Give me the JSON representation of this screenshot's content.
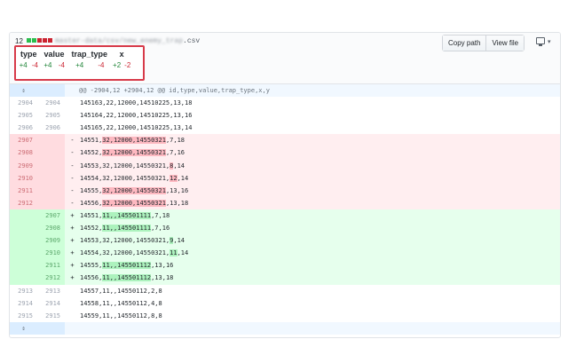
{
  "file": {
    "diffstat_count": "12",
    "diffstat_blocks": [
      "#2cbe4e",
      "#2cbe4e",
      "#cb2431",
      "#cb2431",
      "#cb2431"
    ],
    "path_blurred": "master-data/csv/new_enemy_trap",
    "path_ext": ".csv",
    "copy_path_label": "Copy path",
    "view_file_label": "View file",
    "display_icon": "monitor-icon",
    "caret_icon": "caret-down"
  },
  "summary": {
    "headers": [
      "type",
      "value",
      "trap_type",
      "x"
    ],
    "values": [
      "+4",
      "-4",
      "+4",
      "-4",
      "+4",
      "-4",
      "+2",
      "-2"
    ]
  },
  "hunk": {
    "expand_icon": "⇕",
    "header": "@@ -2904,12 +2904,12 @@ id,type,value,trap_type,x,y",
    "end_icon": "⇕"
  },
  "colors": {
    "del_bg": "#ffeef0",
    "del_highlight": "#fdb8c0",
    "add_bg": "#e6ffed",
    "add_highlight": "#acf2bd",
    "annotation_border": "#d73a49"
  },
  "context_top": [
    {
      "old": "2904",
      "new": "2904",
      "text": "145163,22,12000,14510225,13,18"
    },
    {
      "old": "2905",
      "new": "2905",
      "text": "145164,22,12000,14510225,13,16"
    },
    {
      "old": "2906",
      "new": "2906",
      "text": "145165,22,12000,14510225,13,14"
    }
  ],
  "deletions": [
    {
      "old": "2907",
      "sign": "-",
      "parts": [
        {
          "t": "14551,"
        },
        {
          "t": "32,12000,14550321",
          "h": true
        },
        {
          "t": ",7,18"
        }
      ]
    },
    {
      "old": "2908",
      "sign": "-",
      "parts": [
        {
          "t": "14552,"
        },
        {
          "t": "32,12000,14550321",
          "h": true
        },
        {
          "t": ",7,16"
        }
      ]
    },
    {
      "old": "2909",
      "sign": "-",
      "parts": [
        {
          "t": "14553,32,12000,14550321,"
        },
        {
          "t": "8",
          "h": true
        },
        {
          "t": ",14"
        }
      ]
    },
    {
      "old": "2910",
      "sign": "-",
      "parts": [
        {
          "t": "14554,32,12000,14550321,"
        },
        {
          "t": "12",
          "h": true
        },
        {
          "t": ",14"
        }
      ]
    },
    {
      "old": "2911",
      "sign": "-",
      "parts": [
        {
          "t": "14555,"
        },
        {
          "t": "32,12000,14550321",
          "h": true
        },
        {
          "t": ",13,16"
        }
      ]
    },
    {
      "old": "2912",
      "sign": "-",
      "parts": [
        {
          "t": "14556,"
        },
        {
          "t": "32,12000,14550321",
          "h": true
        },
        {
          "t": ",13,18"
        }
      ]
    }
  ],
  "additions": [
    {
      "new": "2907",
      "sign": "+",
      "parts": [
        {
          "t": "14551,"
        },
        {
          "t": "11,,145501111",
          "h": true
        },
        {
          "t": ",7,18"
        }
      ]
    },
    {
      "new": "2908",
      "sign": "+",
      "parts": [
        {
          "t": "14552,"
        },
        {
          "t": "11,,145501111",
          "h": true
        },
        {
          "t": ",7,16"
        }
      ]
    },
    {
      "new": "2909",
      "sign": "+",
      "parts": [
        {
          "t": "14553,32,12000,14550321,"
        },
        {
          "t": "9",
          "h": true
        },
        {
          "t": ",14"
        }
      ]
    },
    {
      "new": "2910",
      "sign": "+",
      "parts": [
        {
          "t": "14554,32,12000,14550321,"
        },
        {
          "t": "11",
          "h": true
        },
        {
          "t": ",14"
        }
      ]
    },
    {
      "new": "2911",
      "sign": "+",
      "parts": [
        {
          "t": "14555,"
        },
        {
          "t": "11,,145501112",
          "h": true
        },
        {
          "t": ",13,16"
        }
      ]
    },
    {
      "new": "2912",
      "sign": "+",
      "parts": [
        {
          "t": "14556,"
        },
        {
          "t": "11,,145501112",
          "h": true
        },
        {
          "t": ",13,18"
        }
      ]
    }
  ],
  "context_bottom": [
    {
      "old": "2913",
      "new": "2913",
      "text": "14557,11,,14550112,2,8"
    },
    {
      "old": "2914",
      "new": "2914",
      "text": "14558,11,,14550112,4,8"
    },
    {
      "old": "2915",
      "new": "2915",
      "text": "14559,11,,14550112,8,8"
    }
  ]
}
